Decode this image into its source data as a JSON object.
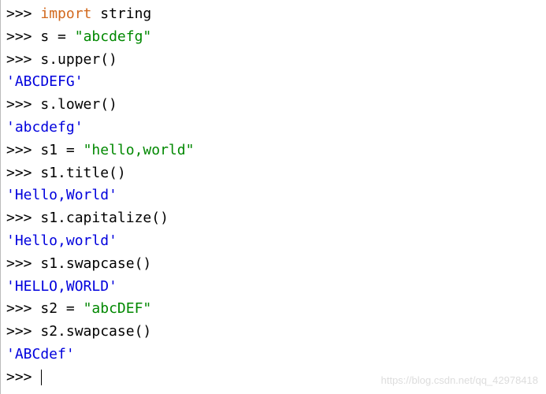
{
  "prompt": ">>> ",
  "lines": [
    {
      "type": "input",
      "parts": [
        {
          "cls": "keyword",
          "text": "import"
        },
        {
          "cls": "identifier",
          "text": " string"
        }
      ]
    },
    {
      "type": "input",
      "parts": [
        {
          "cls": "identifier",
          "text": "s "
        },
        {
          "cls": "operator",
          "text": "="
        },
        {
          "cls": "identifier",
          "text": " "
        },
        {
          "cls": "string",
          "text": "\"abcdefg\""
        }
      ]
    },
    {
      "type": "input",
      "parts": [
        {
          "cls": "identifier",
          "text": "s.upper()"
        }
      ]
    },
    {
      "type": "output",
      "text": "'ABCDEFG'"
    },
    {
      "type": "input",
      "parts": [
        {
          "cls": "identifier",
          "text": "s.lower()"
        }
      ]
    },
    {
      "type": "output",
      "text": "'abcdefg'"
    },
    {
      "type": "input",
      "parts": [
        {
          "cls": "identifier",
          "text": "s1 "
        },
        {
          "cls": "operator",
          "text": "="
        },
        {
          "cls": "identifier",
          "text": " "
        },
        {
          "cls": "string",
          "text": "\"hello,world\""
        }
      ]
    },
    {
      "type": "input",
      "parts": [
        {
          "cls": "identifier",
          "text": "s1.title()"
        }
      ]
    },
    {
      "type": "output",
      "text": "'Hello,World'"
    },
    {
      "type": "input",
      "parts": [
        {
          "cls": "identifier",
          "text": "s1.capitalize()"
        }
      ]
    },
    {
      "type": "output",
      "text": "'Hello,world'"
    },
    {
      "type": "input",
      "parts": [
        {
          "cls": "identifier",
          "text": "s1.swapcase()"
        }
      ]
    },
    {
      "type": "output",
      "text": "'HELLO,WORLD'"
    },
    {
      "type": "input",
      "parts": [
        {
          "cls": "identifier",
          "text": "s2 "
        },
        {
          "cls": "operator",
          "text": "="
        },
        {
          "cls": "identifier",
          "text": " "
        },
        {
          "cls": "string",
          "text": "\"abcDEF\""
        }
      ]
    },
    {
      "type": "input",
      "parts": [
        {
          "cls": "identifier",
          "text": "s2.swapcase()"
        }
      ]
    },
    {
      "type": "output",
      "text": "'ABCdef'"
    },
    {
      "type": "cursor"
    }
  ],
  "watermark": "https://blog.csdn.net/qq_42978418"
}
